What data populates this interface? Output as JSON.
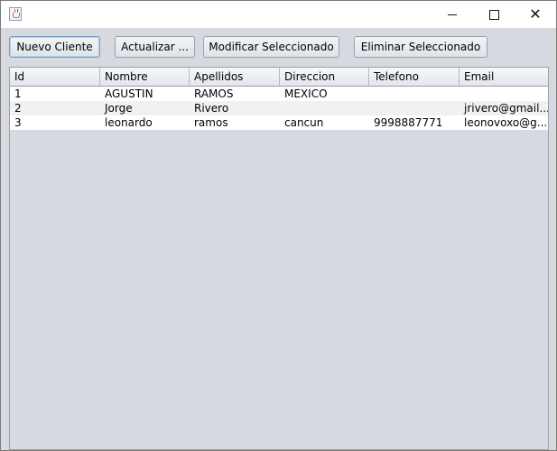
{
  "toolbar": {
    "new_client": "Nuevo Cliente",
    "refresh": "Actualizar ...",
    "modify": "Modificar Seleccionado",
    "delete": "Eliminar Seleccionado"
  },
  "table": {
    "headers": [
      "Id",
      "Nombre",
      "Apellidos",
      "Direccion",
      "Telefono",
      "Email"
    ],
    "rows": [
      [
        "1",
        "AGUSTIN",
        "RAMOS",
        "MEXICO",
        "",
        ""
      ],
      [
        "2",
        "Jorge",
        "Rivero",
        "",
        "",
        "jrivero@gmail...."
      ],
      [
        "3",
        "leonardo",
        "ramos",
        "cancun",
        "9998887771",
        "leonovoxo@g..."
      ]
    ]
  },
  "icons": {
    "app": "java-app-icon",
    "minimize": "minimize-icon",
    "maximize": "maximize-icon",
    "close": "close-icon"
  },
  "colors": {
    "background": "#d6d9df",
    "row_odd": "#ffffff",
    "row_even": "#f0f1f3"
  }
}
